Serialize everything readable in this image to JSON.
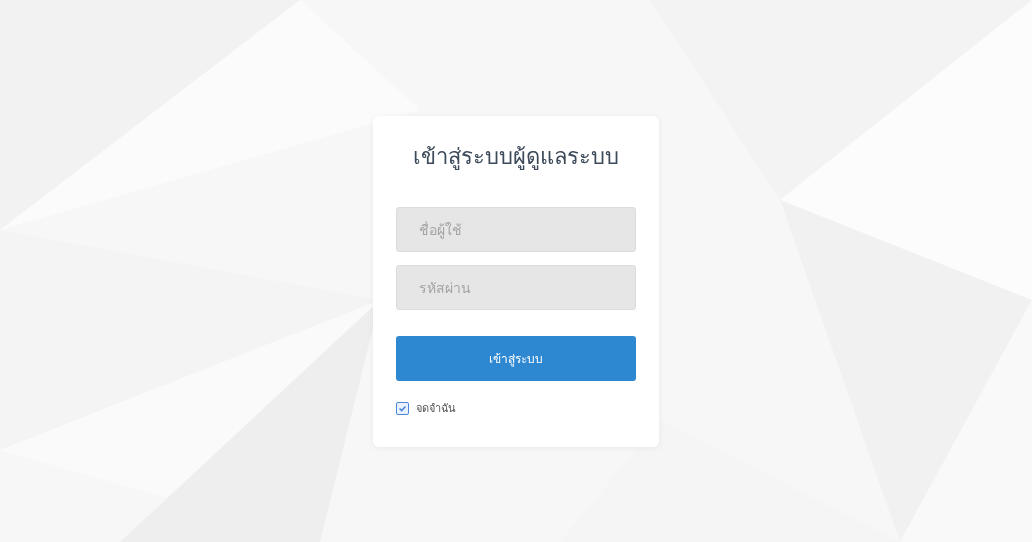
{
  "login": {
    "title": "เข้าสู่ระบบผู้ดูแลระบบ",
    "fields": [
      {
        "placeholder": "ชื่อผู้ใช้"
      },
      {
        "placeholder": "รหัสผ่าน"
      }
    ],
    "submit": "เข้าสู่ระบบ",
    "remember": {
      "label": "จดจำฉัน",
      "checked": true
    }
  }
}
